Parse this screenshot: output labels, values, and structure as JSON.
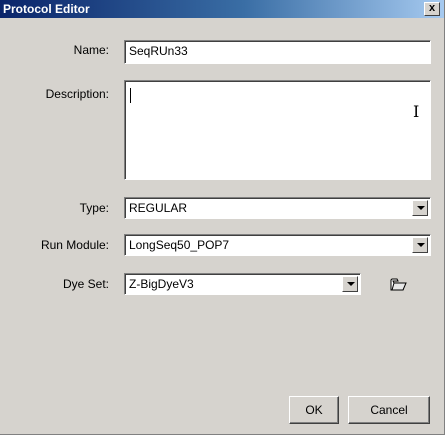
{
  "window": {
    "title": "Protocol Editor",
    "close_glyph": "x"
  },
  "form": {
    "name_label": "Name:",
    "name_value": "SeqRUn33",
    "description_label": "Description:",
    "description_value": "",
    "type_label": "Type:",
    "type_value": "REGULAR",
    "run_module_label": "Run Module:",
    "run_module_value": "LongSeq50_POP7",
    "dye_set_label": "Dye Set:",
    "dye_set_value": "Z-BigDyeV3"
  },
  "buttons": {
    "ok": "OK",
    "cancel": "Cancel"
  },
  "icons": {
    "close": "close-icon",
    "folder": "folder-open-icon",
    "dropdown": "chevron-down-icon",
    "cursor": "text-cursor-icon"
  },
  "colors": {
    "dialog_bg": "#d6d3ce",
    "title_start": "#0a246a",
    "title_end": "#a6caf0"
  }
}
